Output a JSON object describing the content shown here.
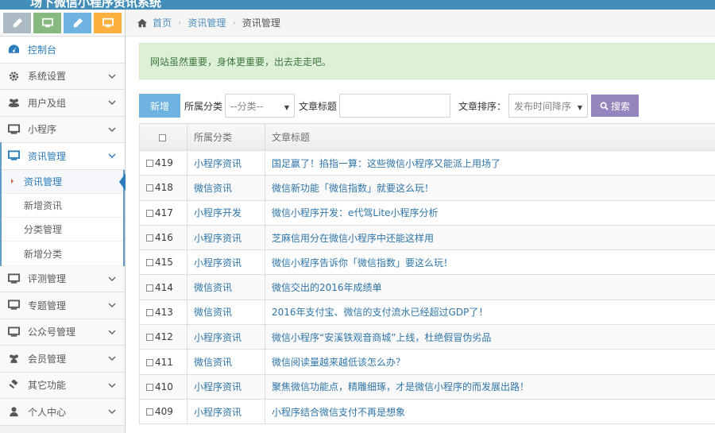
{
  "topbar": {
    "brand": "场下微信小程序资讯系统"
  },
  "shortcuts": [
    {
      "icon": "pencil-icon",
      "color": "#abbac3"
    },
    {
      "icon": "monitor-icon",
      "color": "#87b87f"
    },
    {
      "icon": "pencil-icon",
      "color": "#6fb3e0"
    },
    {
      "icon": "monitor-icon",
      "color": "#fcb040"
    }
  ],
  "nav": {
    "dashboard": "控制台",
    "system_settings": "系统设置",
    "users_groups": "用户及组",
    "mini_program": "小程序",
    "news_mgmt": "资讯管理",
    "sub": [
      "资讯管理",
      "新增资讯",
      "分类管理",
      "新增分类"
    ],
    "review_mgmt": "评测管理",
    "topic_mgmt": "专题管理",
    "official_account_mgmt": "公众号管理",
    "member_mgmt": "会员管理",
    "other_functions": "其它功能",
    "personal_center": "个人中心"
  },
  "breadcrumb": {
    "home": "首页",
    "level1": "资讯管理",
    "current": "资讯管理"
  },
  "alert": "网站虽然重要，身体更重要，出去走走吧。",
  "filter": {
    "add_label": "新增",
    "category_label": "所属分类",
    "category_value": "--分类--",
    "title_label": "文章标题",
    "title_value": "",
    "sort_label": "文章排序：",
    "sort_value": "发布时间降序",
    "search_label": "搜索"
  },
  "table": {
    "columns": [
      "",
      "所属分类",
      "文章标题"
    ],
    "rows": [
      {
        "id": "419",
        "category": "小程序资讯",
        "title": "国足赢了！掐指一算：这些微信小程序又能派上用场了"
      },
      {
        "id": "418",
        "category": "微信资讯",
        "title": "微信新功能「微信指数」就要这么玩！"
      },
      {
        "id": "417",
        "category": "小程序开发",
        "title": "微信小程序开发：e代驾Lite小程序分析"
      },
      {
        "id": "416",
        "category": "小程序资讯",
        "title": "芝麻信用分在微信小程序中还能这样用"
      },
      {
        "id": "415",
        "category": "小程序资讯",
        "title": "微信小程序告诉你「微信指数」要这么玩！"
      },
      {
        "id": "414",
        "category": "微信资讯",
        "title": "微信交出的2016年成绩单"
      },
      {
        "id": "413",
        "category": "微信资讯",
        "title": "2016年支付宝、微信的支付流水已经超过GDP了！"
      },
      {
        "id": "412",
        "category": "小程序资讯",
        "title": "微信小程序“安溪铁观音商城”上线，杜绝假冒伪劣品"
      },
      {
        "id": "411",
        "category": "微信资讯",
        "title": "微信阅读量越来越低该怎么办？"
      },
      {
        "id": "410",
        "category": "小程序资讯",
        "title": "聚焦微信功能点，精雕细琢，才是微信小程序的而发展出路！"
      },
      {
        "id": "409",
        "category": "小程序资讯",
        "title": "小程序结合微信支付不再是想象"
      }
    ]
  }
}
